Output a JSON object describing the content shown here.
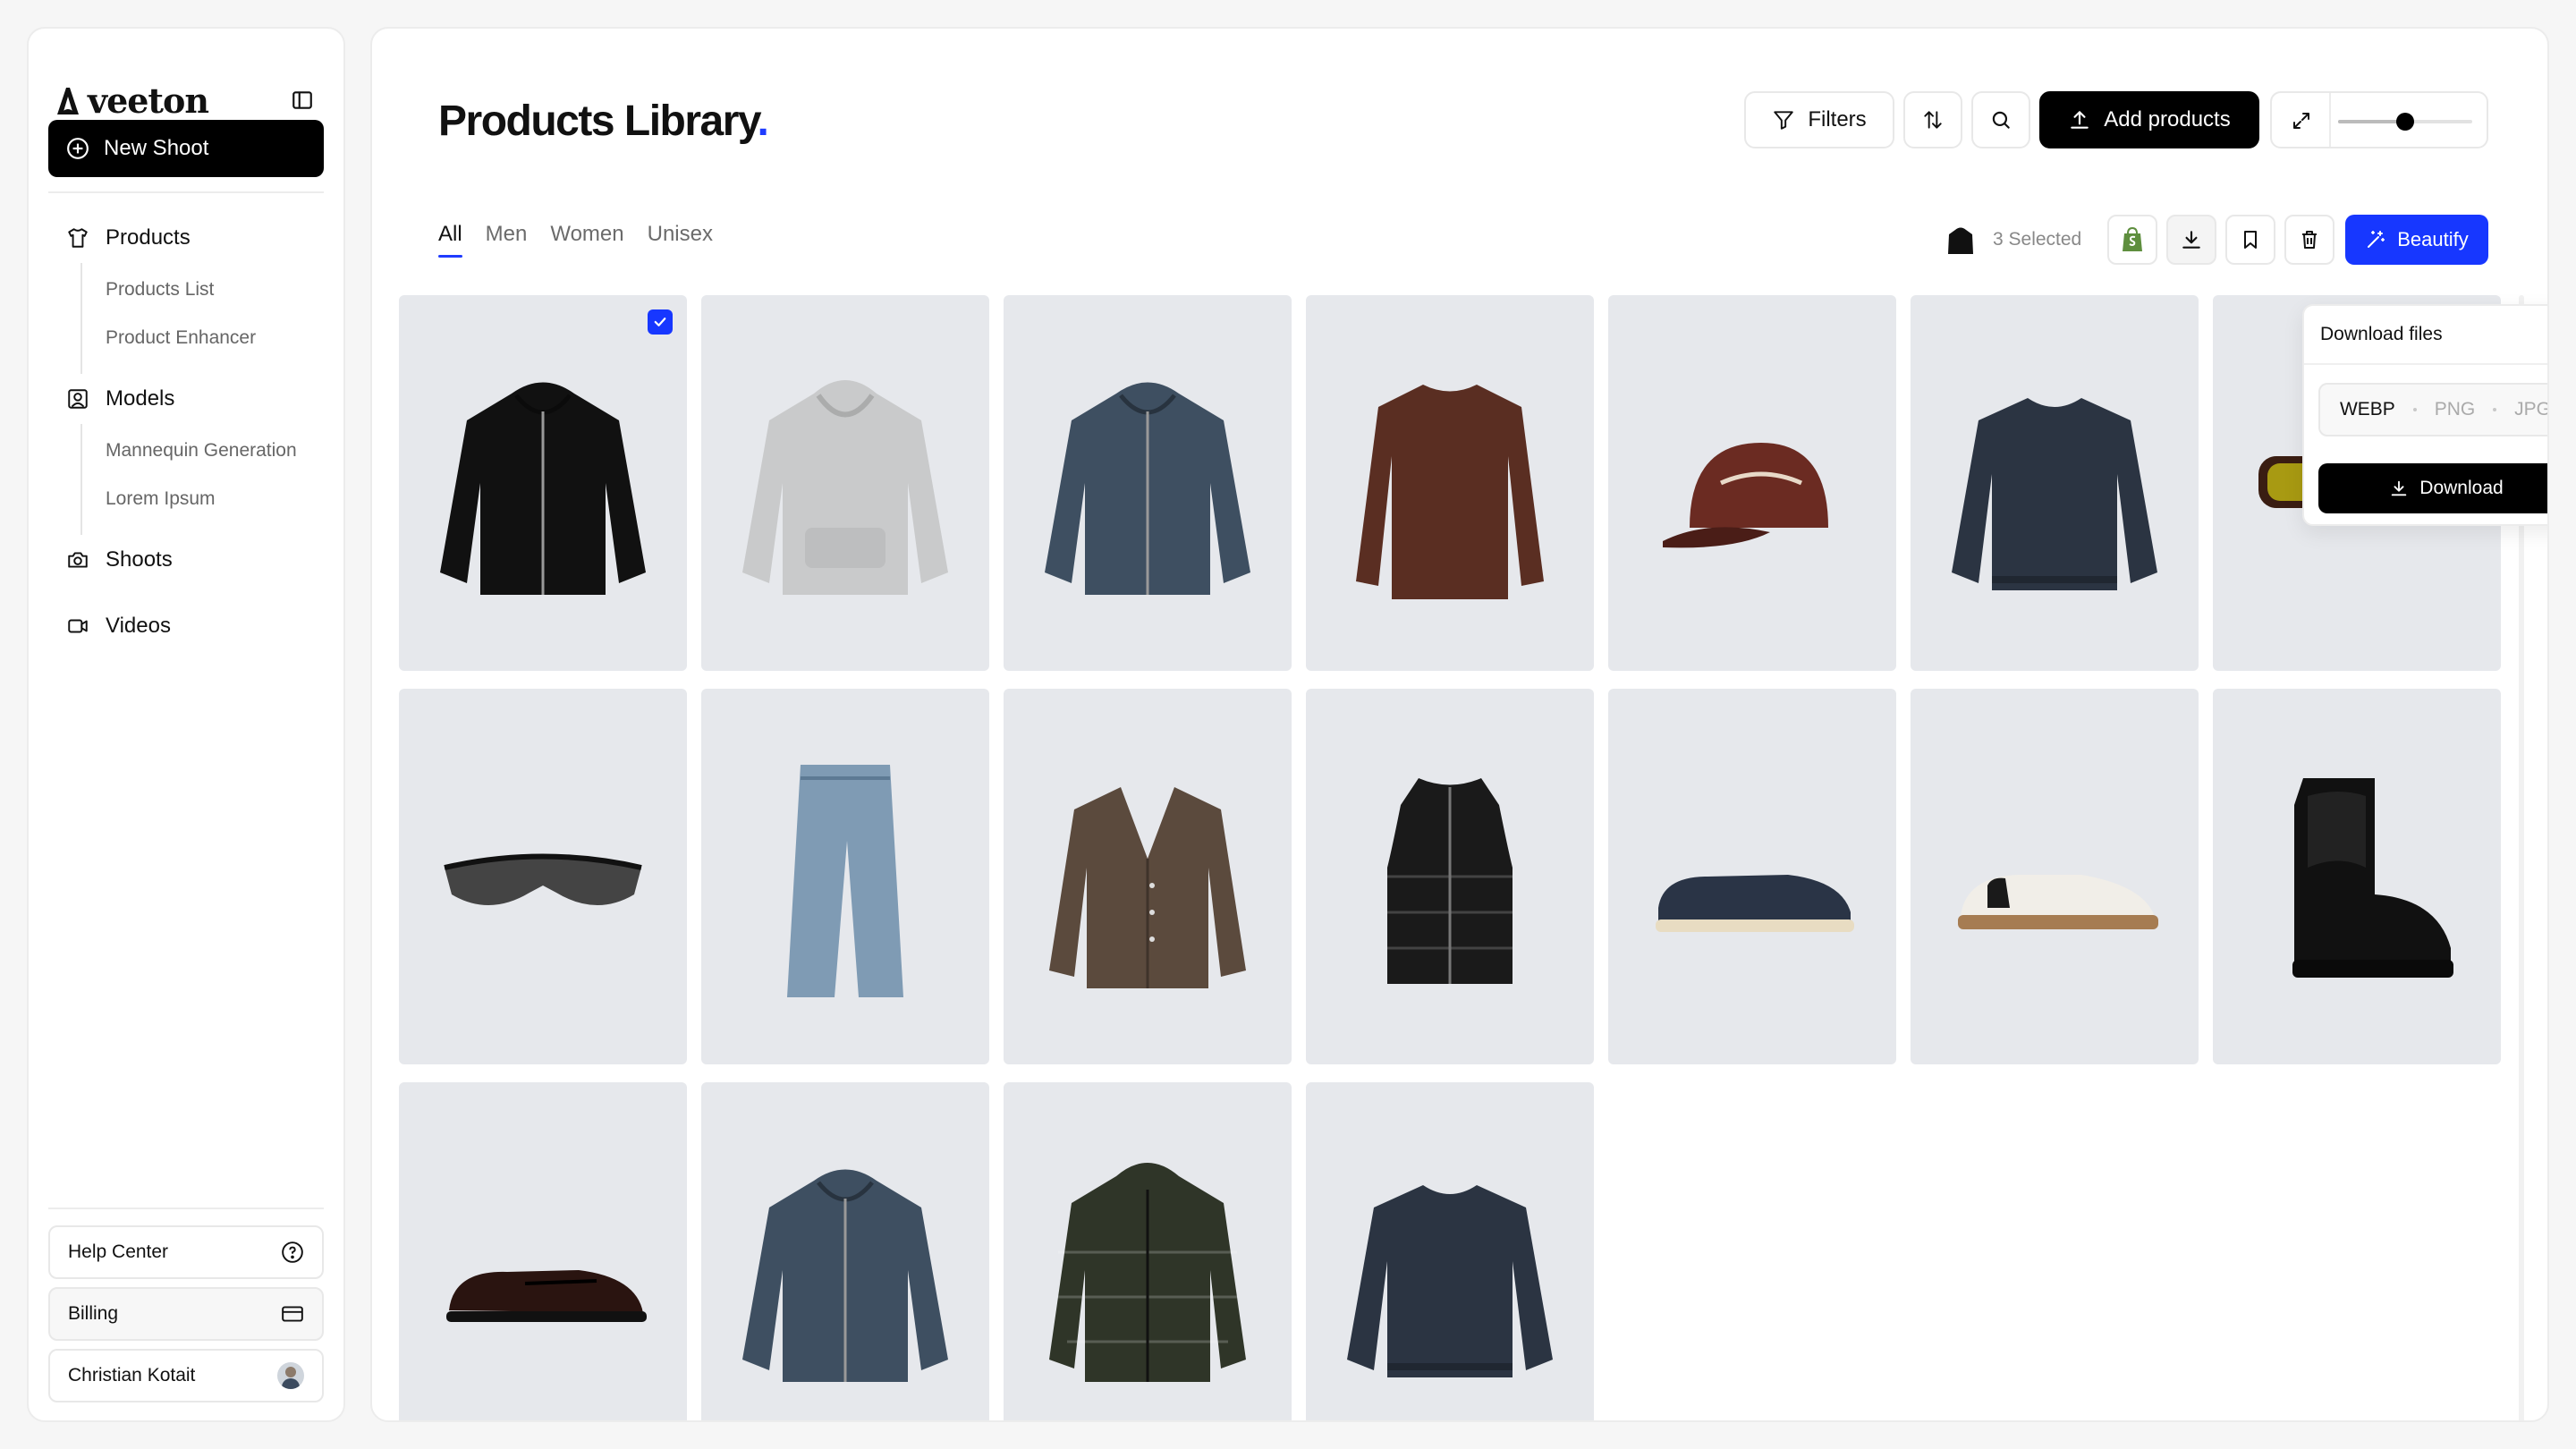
{
  "brand": {
    "name": "veeton"
  },
  "sidebar": {
    "new_shoot_label": "New Shoot",
    "nav": [
      {
        "label": "Products",
        "icon": "shirt-icon",
        "children": [
          "Products List",
          "Product Enhancer"
        ]
      },
      {
        "label": "Models",
        "icon": "user-frame-icon",
        "children": [
          "Mannequin Generation",
          "Lorem Ipsum"
        ]
      },
      {
        "label": "Shoots",
        "icon": "camera-icon"
      },
      {
        "label": "Videos",
        "icon": "video-icon"
      }
    ],
    "footer": {
      "help_center": "Help Center",
      "billing": "Billing",
      "user_name": "Christian Kotait"
    }
  },
  "header": {
    "title": "Products Library",
    "title_dot": ".",
    "filters_label": "Filters",
    "add_products_label": "Add products",
    "zoom_level": 0.5
  },
  "tabs": [
    {
      "label": "All",
      "active": true
    },
    {
      "label": "Men",
      "active": false
    },
    {
      "label": "Women",
      "active": false
    },
    {
      "label": "Unisex",
      "active": false
    }
  ],
  "selection": {
    "count_label": "3 Selected",
    "beautify_label": "Beautify"
  },
  "download_popover": {
    "title": "Download files",
    "formats": [
      {
        "label": "WEBP",
        "active": true
      },
      {
        "label": "PNG",
        "active": false
      },
      {
        "label": "JPG",
        "active": false
      }
    ],
    "download_label": "Download"
  },
  "colors": {
    "accent": "#1737ff",
    "title_dot": "#1f3cff",
    "card_bg": "#e6e8ec"
  },
  "products": [
    {
      "kind": "zip-hoodie",
      "color": "#111111",
      "selected": true
    },
    {
      "kind": "hoodie",
      "color": "#c9cacb",
      "selected": false
    },
    {
      "kind": "zip-hoodie",
      "color": "#3e4f61",
      "selected": false
    },
    {
      "kind": "longsleeve",
      "color": "#5a2e22",
      "selected": false
    },
    {
      "kind": "cap",
      "color": "#6b2b22",
      "selected": false
    },
    {
      "kind": "sweater",
      "color": "#2b3442",
      "selected": false
    },
    {
      "kind": "sunglasses",
      "color": "#a89a12",
      "selected": false
    },
    {
      "kind": "sport-sunglasses",
      "color": "#444444",
      "selected": false
    },
    {
      "kind": "jeans",
      "color": "#7f9bb4",
      "selected": false
    },
    {
      "kind": "cardigan",
      "color": "#5b4a3d",
      "selected": false
    },
    {
      "kind": "vest",
      "color": "#1a1a1a",
      "selected": false
    },
    {
      "kind": "loafer",
      "color": "#2a3446",
      "selected": false
    },
    {
      "kind": "sneaker",
      "color": "#f1eee8",
      "selected": false
    },
    {
      "kind": "chelsea-boot",
      "color": "#111111",
      "selected": false
    },
    {
      "kind": "penny-loafer",
      "color": "#2a1410",
      "selected": false
    },
    {
      "kind": "zip-hoodie",
      "color": "#3e4f61",
      "selected": false
    },
    {
      "kind": "puffer",
      "color": "#2f3528",
      "selected": false
    },
    {
      "kind": "sweater",
      "color": "#2b3442",
      "selected": false
    }
  ]
}
